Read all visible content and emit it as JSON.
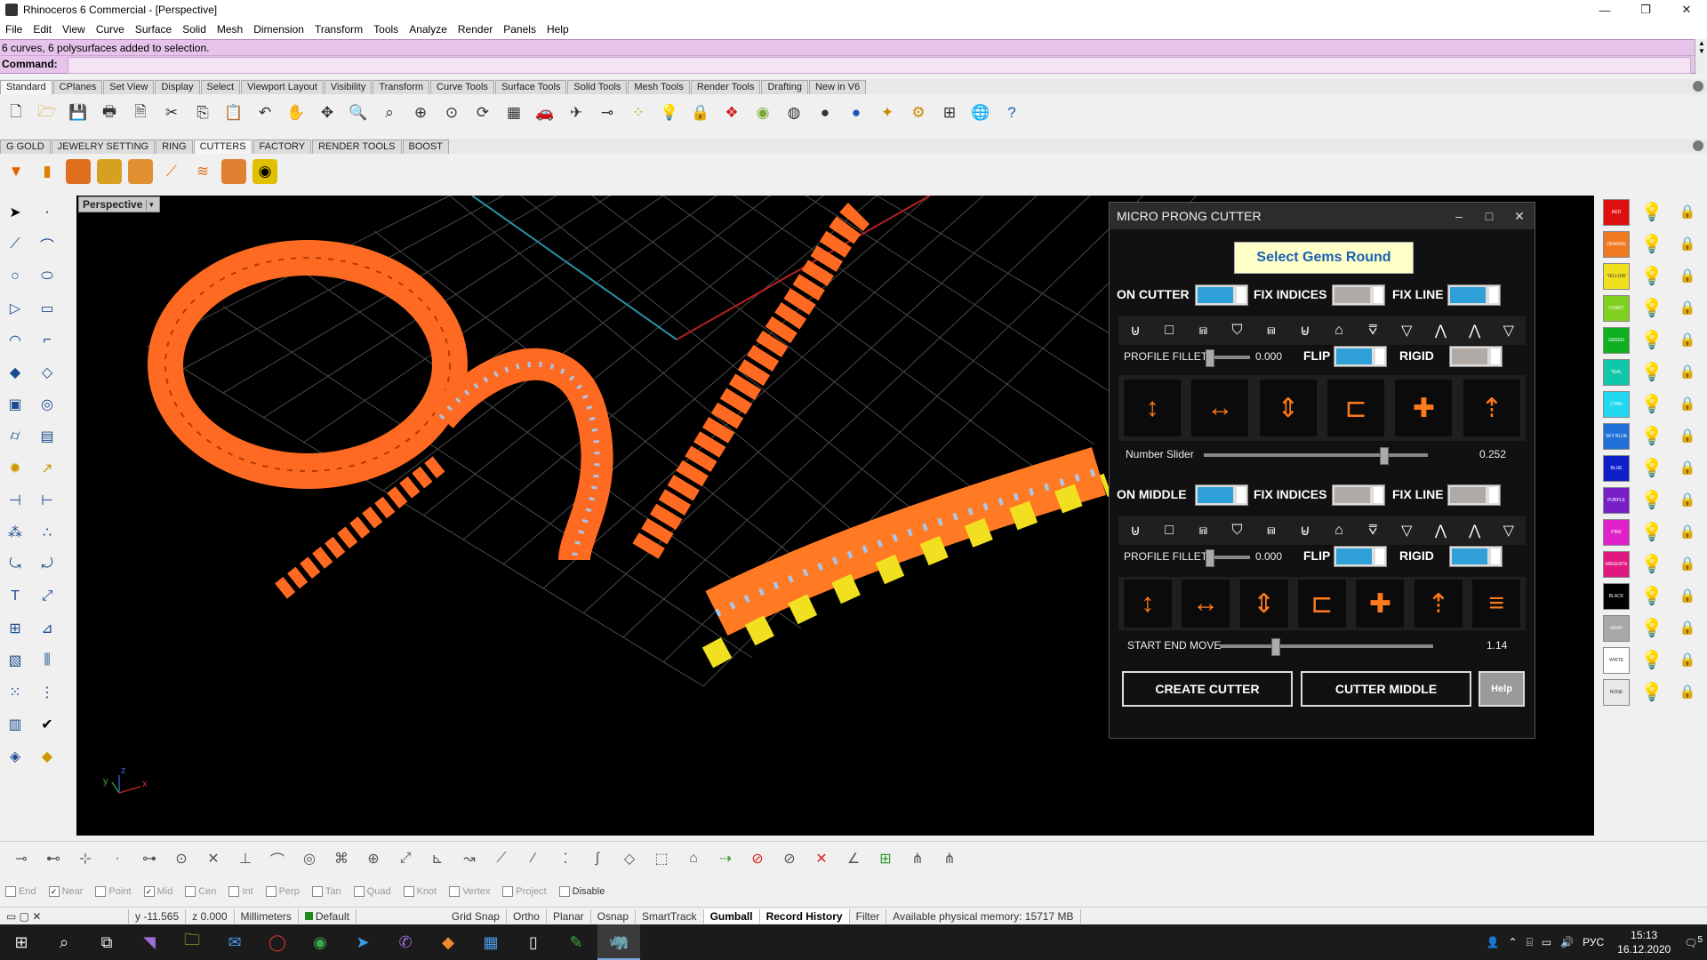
{
  "window": {
    "title": "Rhinoceros 6 Commercial - [Perspective]",
    "min": "—",
    "max": "❐",
    "close": "✕"
  },
  "menu": [
    "File",
    "Edit",
    "View",
    "Curve",
    "Surface",
    "Solid",
    "Mesh",
    "Dimension",
    "Transform",
    "Tools",
    "Analyze",
    "Render",
    "Panels",
    "Help"
  ],
  "command": {
    "history": "6 curves, 6 polysurfaces added to selection.",
    "prompt": "Command:",
    "value": ""
  },
  "toolbar_tabs": [
    "Standard",
    "CPlanes",
    "Set View",
    "Display",
    "Select",
    "Viewport Layout",
    "Visibility",
    "Transform",
    "Curve Tools",
    "Surface Tools",
    "Solid Tools",
    "Mesh Tools",
    "Render Tools",
    "Drafting",
    "New in V6"
  ],
  "toolbar_tabs_active": "Standard",
  "plugin_tabs": [
    "G GOLD",
    "JEWELRY SETTING",
    "RING",
    "CUTTERS",
    "FACTORY",
    "RENDER TOOLS",
    "BOOST"
  ],
  "plugin_tabs_active": "CUTTERS",
  "viewport": {
    "label": "Perspective",
    "axis_x": "x",
    "axis_y": "y",
    "axis_z": "z"
  },
  "dialog": {
    "title": "MICRO PRONG CUTTER",
    "select_gems": "Select Gems Round",
    "on_cutter": "ON CUTTER",
    "fix_indices": "FIX INDICES",
    "fix_line": "FIX LINE",
    "profile_fillet": "PROFILE FILLET",
    "profile_fillet_value_1": "0.000",
    "flip": "FLIP",
    "rigid": "RIGID",
    "number_slider": "Number Slider",
    "number_slider_value": "0.252",
    "on_middle": "ON MIDDLE",
    "fix_indices_2": "FIX INDICES",
    "fix_line_2": "FIX LINE",
    "profile_fillet_2": "PROFILE FILLET",
    "profile_fillet_value_2": "0.000",
    "flip_2": "FLIP",
    "rigid_2": "RIGID",
    "start_end_move": "START END MOVE",
    "start_end_move_value": "1.14",
    "create_cutter": "CREATE CUTTER",
    "cutter_middle": "CUTTER MIDDLE",
    "help": "Help"
  },
  "colors": [
    "RED",
    "ORANGE",
    "YELLOW",
    "CHART",
    "GREEN",
    "TEAL",
    "CYAN",
    "SKY BLUE",
    "BLUE",
    "PURPLE",
    "PINK",
    "MAGENTA",
    "BLACK",
    "GRAY",
    "WHITE",
    "NONE"
  ],
  "osnap": [
    {
      "label": "End",
      "checked": false
    },
    {
      "label": "Near",
      "checked": true
    },
    {
      "label": "Point",
      "checked": false
    },
    {
      "label": "Mid",
      "checked": true
    },
    {
      "label": "Cen",
      "checked": false
    },
    {
      "label": "Int",
      "checked": false
    },
    {
      "label": "Perp",
      "checked": false
    },
    {
      "label": "Tan",
      "checked": false
    },
    {
      "label": "Quad",
      "checked": false
    },
    {
      "label": "Knot",
      "checked": false
    },
    {
      "label": "Vertex",
      "checked": false
    },
    {
      "label": "Project",
      "checked": false
    },
    {
      "label": "Disable",
      "checked": false
    }
  ],
  "status": {
    "y": "y -11.565",
    "z": "z 0.000",
    "units": "Millimeters",
    "layer": "Default",
    "grid_snap": "Grid Snap",
    "ortho": "Ortho",
    "planar": "Planar",
    "osnap": "Osnap",
    "smarttrack": "SmartTrack",
    "gumball": "Gumball",
    "record_history": "Record History",
    "filter": "Filter",
    "memory": "Available physical memory: 15717 MB"
  },
  "taskbar": {
    "lang": "РУС",
    "time": "15:13",
    "date": "16.12.2020",
    "notifications": "5"
  }
}
